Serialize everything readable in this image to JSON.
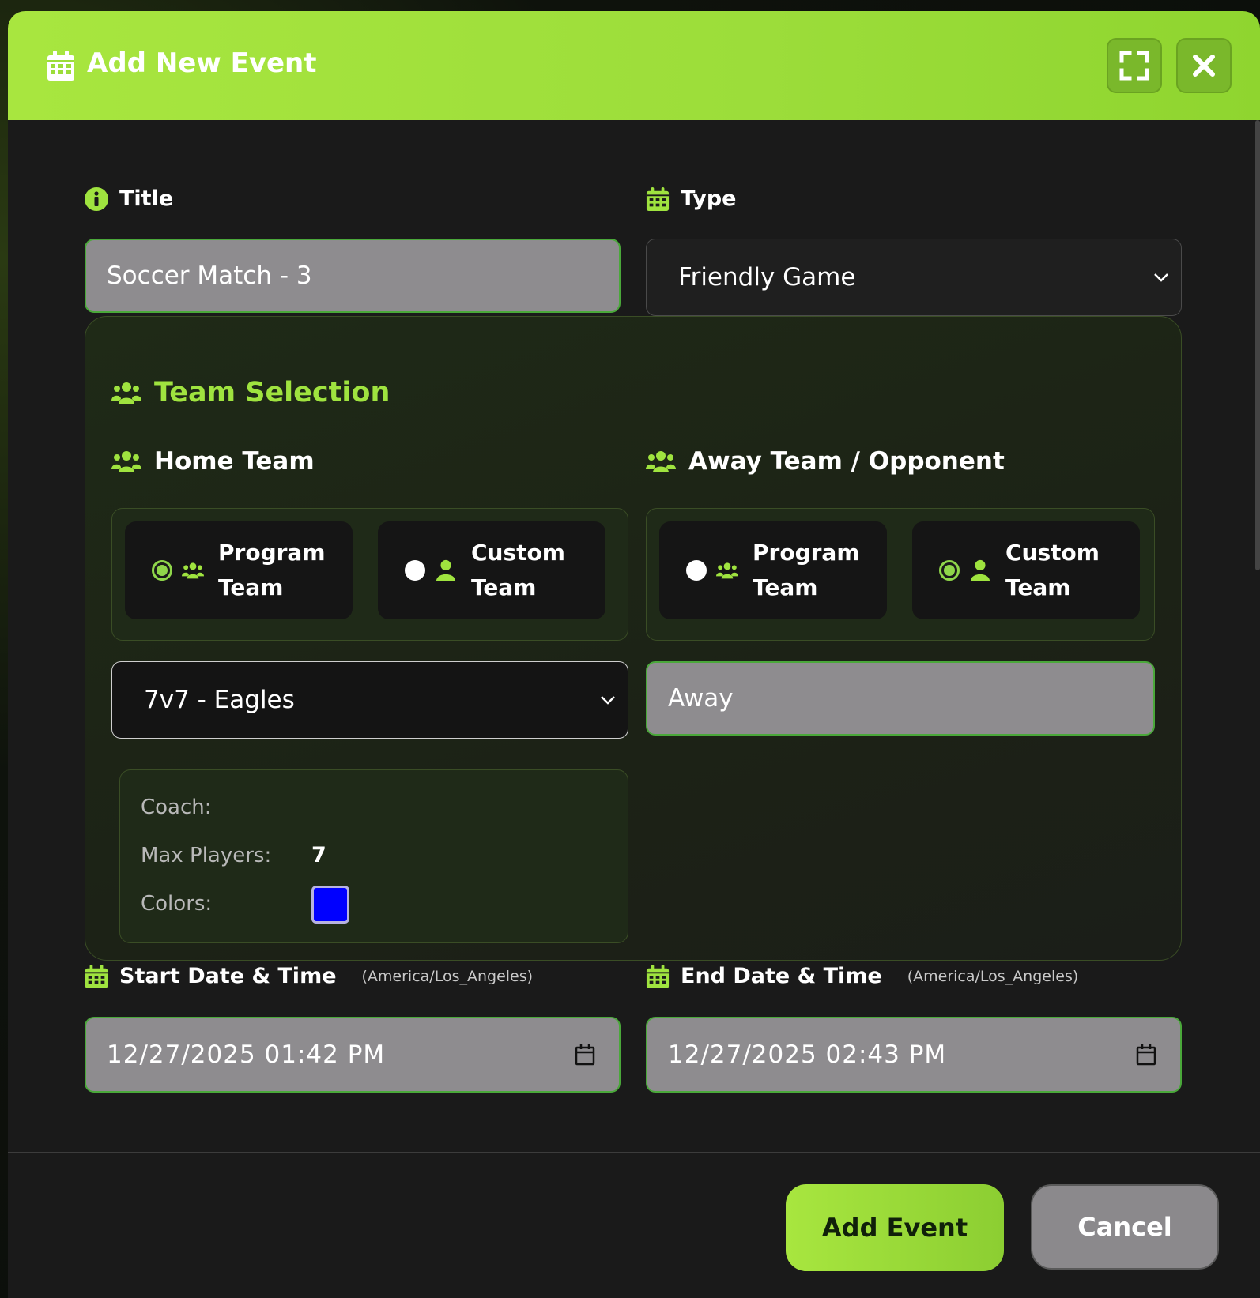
{
  "header": {
    "title": "Add New Event"
  },
  "form": {
    "title_label": "Title",
    "title_value": "Soccer Match - 3",
    "type_label": "Type",
    "type_value": "Friendly Game"
  },
  "team_selection": {
    "heading": "Team Selection",
    "home": {
      "heading": "Home Team",
      "options": [
        {
          "label_line1": "Program",
          "label_line2": "Team",
          "selected": true
        },
        {
          "label_line1": "Custom",
          "label_line2": "Team",
          "selected": false
        }
      ],
      "selected_team": "7v7 - Eagles",
      "info": {
        "coach_label": "Coach:",
        "coach_value": "",
        "max_players_label": "Max Players:",
        "max_players_value": "7",
        "colors_label": "Colors:",
        "color_value": "#0000ff"
      }
    },
    "away": {
      "heading": "Away Team / Opponent",
      "options": [
        {
          "label_line1": "Program",
          "label_line2": "Team",
          "selected": false
        },
        {
          "label_line1": "Custom",
          "label_line2": "Team",
          "selected": true
        }
      ],
      "custom_team_value": "Away"
    }
  },
  "dates": {
    "start_label": "Start Date & Time",
    "start_tz": "(America/Los_Angeles)",
    "start_value": "12/27/2025 01:42 PM",
    "end_label": "End Date & Time",
    "end_tz": "(America/Los_Angeles)",
    "end_value": "12/27/2025 02:43 PM"
  },
  "footer": {
    "primary_label": "Add Event",
    "secondary_label": "Cancel"
  },
  "icons": {
    "header": "calendar-icon",
    "expand": "expand-icon",
    "close": "close-icon",
    "title": "info-icon",
    "type": "calendar-icon",
    "teams": "users-icon",
    "custom_team": "user-icon"
  },
  "colors": {
    "accent": "#9fe33f",
    "modal_bg": "#1a1a1a",
    "field_bg": "#8e8c8f",
    "team_color": "#0000ff"
  }
}
